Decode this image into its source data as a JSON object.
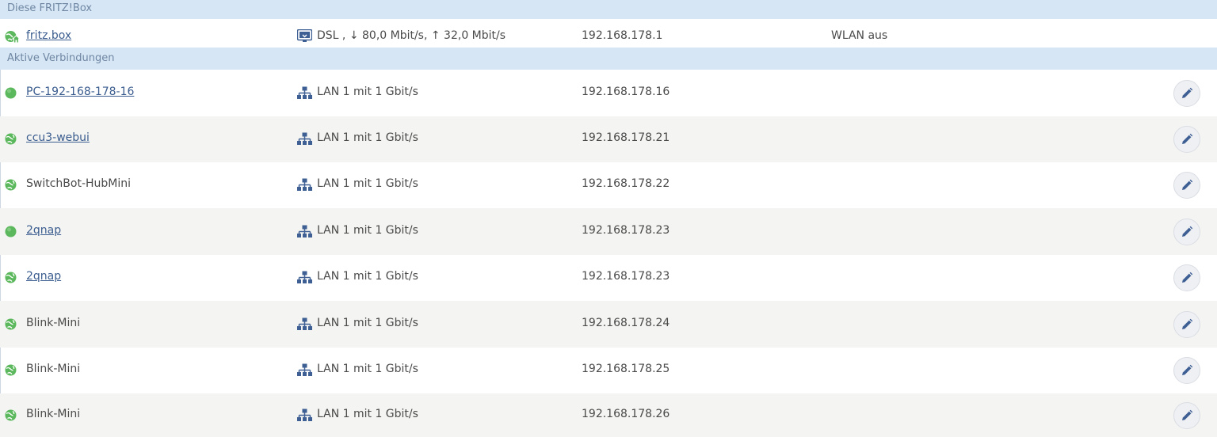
{
  "sections": {
    "this_box": "Diese FRITZ!Box",
    "active": "Aktive Verbindungen"
  },
  "box": {
    "name": "fritz.box",
    "connection": "DSL , ↓ 80,0 Mbit/s, ↑ 32,0 Mbit/s",
    "ip": "192.168.178.1",
    "wlan": "WLAN aus",
    "status_icon": "globe-home-icon",
    "connection_icon": "dsl-icon"
  },
  "devices": [
    {
      "name": "PC-192-168-178-16",
      "connection": "LAN 1 mit 1 Gbit/s",
      "ip": "192.168.178.16",
      "status_icon": "green-dot-icon",
      "link": true
    },
    {
      "name": "ccu3-webui",
      "connection": "LAN 1 mit 1 Gbit/s",
      "ip": "192.168.178.21",
      "status_icon": "globe-icon",
      "link": true
    },
    {
      "name": "SwitchBot-HubMini",
      "connection": "LAN 1 mit 1 Gbit/s",
      "ip": "192.168.178.22",
      "status_icon": "globe-icon",
      "link": false
    },
    {
      "name": "2qnap",
      "connection": "LAN 1 mit 1 Gbit/s",
      "ip": "192.168.178.23",
      "status_icon": "green-dot-icon",
      "link": true
    },
    {
      "name": "2qnap",
      "connection": "LAN 1 mit 1 Gbit/s",
      "ip": "192.168.178.23",
      "status_icon": "globe-icon",
      "link": true
    },
    {
      "name": "Blink-Mini",
      "connection": "LAN 1 mit 1 Gbit/s",
      "ip": "192.168.178.24",
      "status_icon": "globe-icon",
      "link": false
    },
    {
      "name": "Blink-Mini",
      "connection": "LAN 1 mit 1 Gbit/s",
      "ip": "192.168.178.25",
      "status_icon": "globe-icon",
      "link": false
    },
    {
      "name": "Blink-Mini",
      "connection": "LAN 1 mit 1 Gbit/s",
      "ip": "192.168.178.26",
      "status_icon": "globe-icon",
      "link": false
    }
  ],
  "colors": {
    "header_bg": "#d6e6f5",
    "header_text": "#6f87a3",
    "link": "#3b5d8f",
    "status_green": "#5cb85c",
    "alt_row_bg": "#f4f4f2",
    "icon_blue": "#3e5f94"
  }
}
